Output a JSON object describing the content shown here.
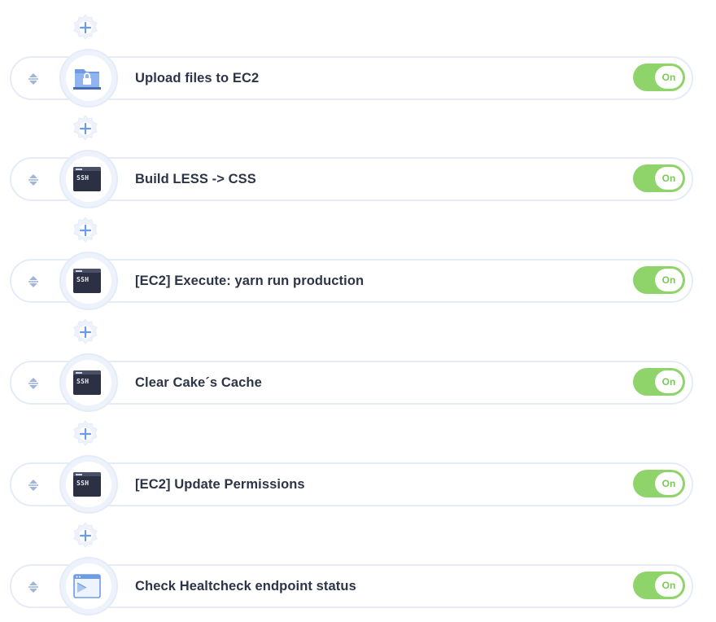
{
  "steps": [
    {
      "title": "Upload files to EC2",
      "icon": "upload-folder-icon",
      "toggle": "On"
    },
    {
      "title": "Build LESS -> CSS",
      "icon": "ssh-terminal-icon",
      "toggle": "On",
      "icon_text": "SSH"
    },
    {
      "title": "[EC2] Execute: yarn run production",
      "icon": "ssh-terminal-icon",
      "toggle": "On",
      "icon_text": "SSH"
    },
    {
      "title": "Clear Cake´s Cache",
      "icon": "ssh-terminal-icon",
      "toggle": "On",
      "icon_text": "SSH"
    },
    {
      "title": "[EC2] Update Permissions",
      "icon": "ssh-terminal-icon",
      "toggle": "On",
      "icon_text": "SSH"
    },
    {
      "title": "Check Healtcheck endpoint status",
      "icon": "healthcheck-browser-icon",
      "toggle": "On"
    }
  ],
  "colors": {
    "toggle_on": "#8fd46a",
    "row_border": "#e4ecf8",
    "hub_fill": "#eef3fb",
    "plus_icon": "#6d9be6",
    "label_text": "#2c3447",
    "terminal": "#2b3142"
  }
}
